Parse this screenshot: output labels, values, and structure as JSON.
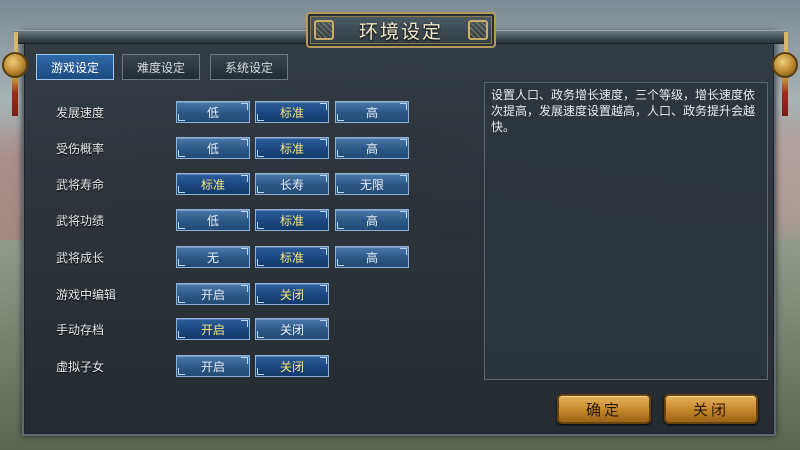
{
  "window": {
    "title": "环境设定"
  },
  "tabs": [
    {
      "label": "游戏设定",
      "active": true
    },
    {
      "label": "难度设定",
      "active": false
    },
    {
      "label": "系统设定",
      "active": false
    }
  ],
  "settings": [
    {
      "label": "发展速度",
      "options": [
        "低",
        "标准",
        "高"
      ],
      "selected": 1
    },
    {
      "label": "受伤概率",
      "options": [
        "低",
        "标准",
        "高"
      ],
      "selected": 1
    },
    {
      "label": "武将寿命",
      "options": [
        "标准",
        "长寿",
        "无限"
      ],
      "selected": 0
    },
    {
      "label": "武将功绩",
      "options": [
        "低",
        "标准",
        "高"
      ],
      "selected": 1
    },
    {
      "label": "武将成长",
      "options": [
        "无",
        "标准",
        "高"
      ],
      "selected": 1
    },
    {
      "label": "游戏中编辑",
      "options": [
        "开启",
        "关闭"
      ],
      "selected": 1
    },
    {
      "label": "手动存档",
      "options": [
        "开启",
        "关闭"
      ],
      "selected": 0
    },
    {
      "label": "虚拟子女",
      "options": [
        "开启",
        "关闭"
      ],
      "selected": 1
    }
  ],
  "description": "设置人口、政务增长速度，三个等级，增长速度依次提高，发展速度设置越高，人口、政务提升会越快。",
  "buttons": {
    "confirm": "确定",
    "close": "关闭"
  },
  "colors": {
    "accent": "#2c5786",
    "selected_text": "#f6e27a",
    "button_gold": "#c98a2e"
  }
}
